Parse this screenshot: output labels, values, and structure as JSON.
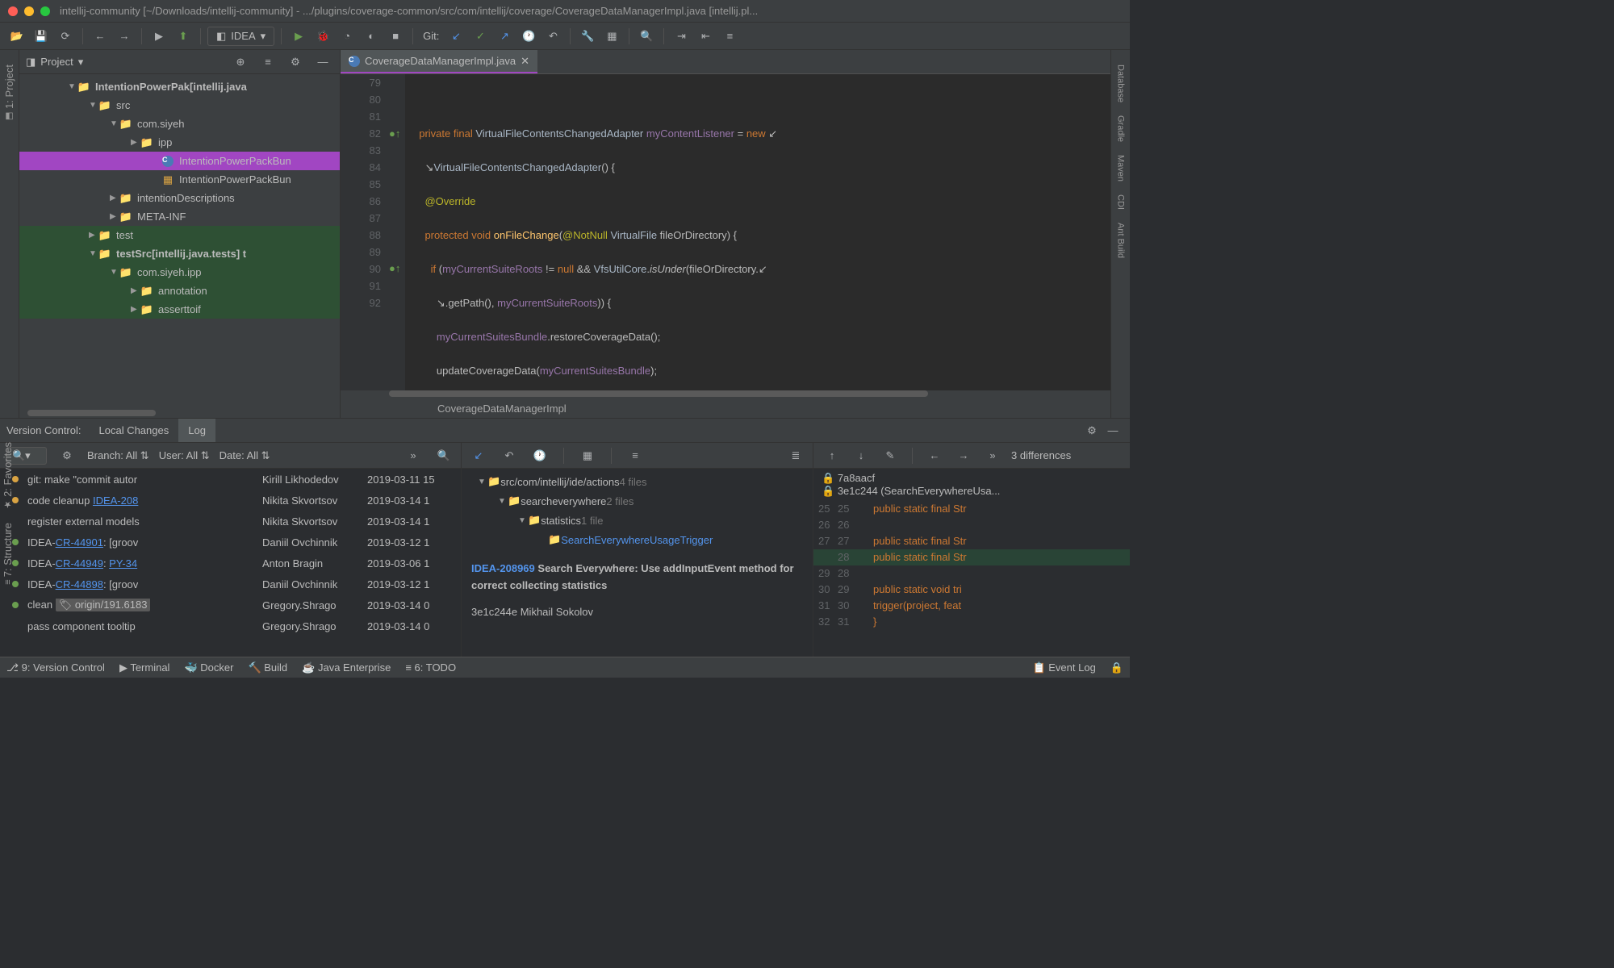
{
  "titlebar": {
    "title": "intellij-community [~/Downloads/intellij-community] - .../plugins/coverage-common/src/com/intellij/coverage/CoverageDataManagerImpl.java [intellij.pl..."
  },
  "toolbar": {
    "config": "IDEA",
    "git_label": "Git:"
  },
  "left_tool_buttons": [
    {
      "label": "1: Project"
    },
    {
      "label": "7: Structure"
    },
    {
      "label": "2: Favorites"
    }
  ],
  "right_tool_buttons": [
    {
      "label": "Database"
    },
    {
      "label": "Gradle"
    },
    {
      "label": "Maven"
    },
    {
      "label": "CDI"
    },
    {
      "label": "Ant Build"
    }
  ],
  "project_panel": {
    "title": "Project",
    "tree": [
      {
        "indent": 60,
        "arrow": "▼",
        "icon": "folder",
        "label": "IntentionPowerPak",
        "suffix": "[intellij.java",
        "bold": true
      },
      {
        "indent": 86,
        "arrow": "▼",
        "icon": "folder-src",
        "label": "src"
      },
      {
        "indent": 112,
        "arrow": "▼",
        "icon": "folder",
        "label": "com.siyeh"
      },
      {
        "indent": 138,
        "arrow": "▶",
        "icon": "folder",
        "label": "ipp"
      },
      {
        "indent": 164,
        "arrow": "",
        "icon": "class",
        "label": "IntentionPowerPackBun",
        "selected": true
      },
      {
        "indent": 164,
        "arrow": "",
        "icon": "resource",
        "label": "IntentionPowerPackBun"
      },
      {
        "indent": 112,
        "arrow": "▶",
        "icon": "folder",
        "label": "intentionDescriptions"
      },
      {
        "indent": 112,
        "arrow": "▶",
        "icon": "folder",
        "label": "META-INF"
      },
      {
        "indent": 86,
        "arrow": "▶",
        "icon": "folder",
        "label": "test",
        "hl": true
      },
      {
        "indent": 86,
        "arrow": "▼",
        "icon": "folder-test",
        "label": "testSrc",
        "suffix": "[intellij.java.tests]  t",
        "bold": true,
        "hl": true
      },
      {
        "indent": 112,
        "arrow": "▼",
        "icon": "folder",
        "label": "com.siyeh.ipp",
        "hl": true
      },
      {
        "indent": 138,
        "arrow": "▶",
        "icon": "folder",
        "label": "annotation",
        "hl": true
      },
      {
        "indent": 138,
        "arrow": "▶",
        "icon": "folder",
        "label": "asserttoif",
        "hl": true
      }
    ]
  },
  "editor": {
    "tab": "CoverageDataManagerImpl.java",
    "line_numbers": [
      "79",
      "80",
      "",
      "81",
      "82",
      "83",
      "",
      "84",
      "85",
      "86",
      "87",
      "88",
      "89",
      "90",
      "91",
      "92"
    ],
    "breadcrumb": "CoverageDataManagerImpl"
  },
  "vcs": {
    "panel_title": "Version Control:",
    "tabs": [
      {
        "label": "Local Changes",
        "active": false
      },
      {
        "label": "Log",
        "active": true
      }
    ],
    "filters": {
      "branch_label": "Branch:",
      "branch_value": "All",
      "user_label": "User:",
      "user_value": "All",
      "date_label": "Date:",
      "date_value": "All"
    },
    "commits": [
      {
        "dot": "y",
        "msg_pre": "git: make \"commit autor",
        "author": "Kirill Likhodedov",
        "date": "2019-03-11 15"
      },
      {
        "dot": "y",
        "msg_pre": "code cleanup ",
        "link": "IDEA-208",
        "author": "Nikita Skvortsov",
        "date": "2019-03-14 1"
      },
      {
        "dot": "",
        "msg_pre": "register external models",
        "author": "Nikita Skvortsov",
        "date": "2019-03-14 1"
      },
      {
        "dot": "g",
        "msg_pre": "IDEA-",
        "link": "CR-44901",
        "msg_post": ": [groov",
        "author": "Daniil Ovchinnik",
        "date": "2019-03-12 1"
      },
      {
        "dot": "g",
        "msg_pre": "IDEA-",
        "link": "CR-44949",
        "msg_post": ": ",
        "link2": "PY-34",
        "author": "Anton Bragin",
        "date": "2019-03-06 1"
      },
      {
        "dot": "g",
        "msg_pre": "IDEA-",
        "link": "CR-44898",
        "msg_post": ": [groov",
        "author": "Daniil Ovchinnik",
        "date": "2019-03-12 1"
      },
      {
        "dot": "g",
        "msg_pre": "clean",
        "tag": "origin/191.6183",
        "author": "Gregory.Shrago",
        "date": "2019-03-14 0"
      },
      {
        "dot": "",
        "msg_pre": "pass component tooltip",
        "author": "Gregory.Shrago",
        "date": "2019-03-14 0"
      }
    ],
    "file_tree": [
      {
        "indent": 20,
        "arrow": "▼",
        "label": "src/com/intellij/ide/actions",
        "count": "4 files"
      },
      {
        "indent": 45,
        "arrow": "▼",
        "label": "searcheverywhere",
        "count": "2 files"
      },
      {
        "indent": 70,
        "arrow": "▼",
        "label": "statistics",
        "count": "1 file"
      },
      {
        "indent": 95,
        "arrow": "",
        "label": "SearchEverywhereUsageTrigger",
        "link": true
      }
    ],
    "commit_detail": {
      "id": "IDEA-208969",
      "msg": "Search Everywhere: Use addInputEvent method for correct collecting statistics",
      "hash_author": "3e1c244e Mikhail Sokolov"
    },
    "diff": {
      "nav_label": "3 differences",
      "hash1": "7a8aacf",
      "hash2": "3e1c244 (SearchEverywhereUsa...",
      "lines": [
        {
          "l": "25",
          "r": "25",
          "txt": "public static final Str"
        },
        {
          "l": "26",
          "r": "26",
          "txt": ""
        },
        {
          "l": "27",
          "r": "27",
          "txt": "public static final Str"
        },
        {
          "l": "",
          "r": "28",
          "txt": "public static final Str",
          "add": true
        },
        {
          "l": "29",
          "r": "28",
          "txt": "",
          "gap": true
        },
        {
          "l": "30",
          "r": "29",
          "txt": "public static void tri"
        },
        {
          "l": "31",
          "r": "30",
          "txt": "  trigger(project, feat"
        },
        {
          "l": "32",
          "r": "31",
          "txt": "}"
        }
      ]
    }
  },
  "statusbar": {
    "items": [
      "9: Version Control",
      "Terminal",
      "Docker",
      "Build",
      "Java Enterprise",
      "6: TODO"
    ],
    "event_log": "Event Log"
  }
}
